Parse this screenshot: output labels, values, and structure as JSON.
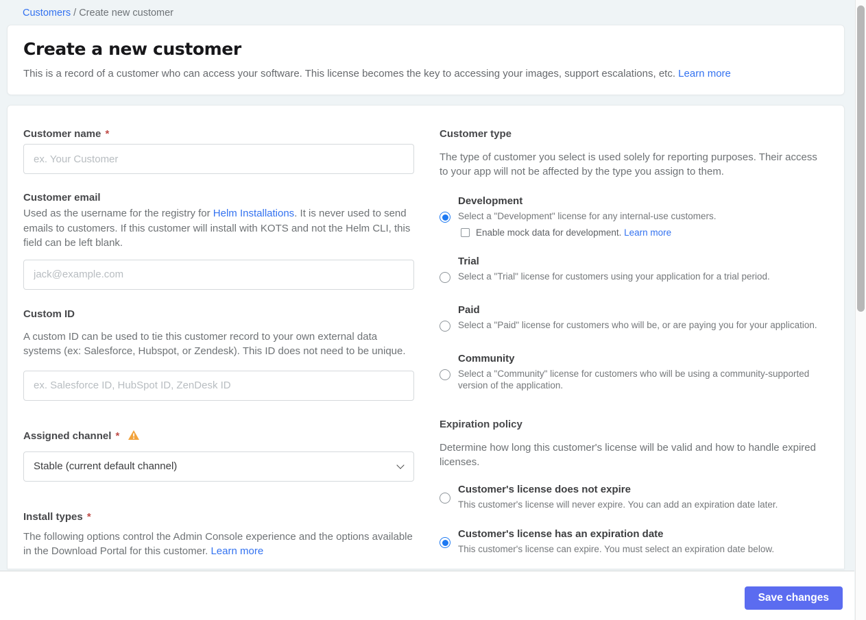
{
  "breadcrumb": {
    "link": "Customers",
    "separator": " / ",
    "current": "Create new customer"
  },
  "header": {
    "title": "Create a new customer",
    "description": "This is a record of a customer who can access your software. This license becomes the key to accessing your images, support escalations, etc. ",
    "learn_more": "Learn more"
  },
  "form": {
    "customer_name": {
      "label": "Customer name",
      "required": "*",
      "placeholder": "ex. Your Customer"
    },
    "customer_email": {
      "label": "Customer email",
      "description_before_link": "Used as the username for the registry for ",
      "link": "Helm Installations",
      "description_after_link": ". It is never used to send emails to customers. If this customer will install with KOTS and not the Helm CLI, this field can be left blank.",
      "placeholder": "jack@example.com"
    },
    "custom_id": {
      "label": "Custom ID",
      "description": "A custom ID can be used to tie this customer record to your own external data systems (ex: Salesforce, Hubspot, or Zendesk). This ID does not need to be unique.",
      "placeholder": "ex. Salesforce ID, HubSpot ID, ZenDesk ID"
    },
    "assigned_channel": {
      "label": "Assigned channel",
      "required": "*",
      "warning_icon": "warning-triangle-icon",
      "selected_option": "Stable (current default channel)"
    },
    "install_types": {
      "label": "Install types",
      "required": "*",
      "description": "The following options control the Admin Console experience and the options available in the Download Portal for this customer. ",
      "learn_more": "Learn more"
    }
  },
  "customer_type": {
    "label": "Customer type",
    "description": "The type of customer you select is used solely for reporting purposes. Their access to your app will not be affected by the type you assign to them.",
    "options": [
      {
        "name": "Development",
        "description": "Select a \"Development\" license for any internal-use customers.",
        "selected": true,
        "checkbox": {
          "label": "Enable mock data for development. ",
          "link": "Learn more",
          "checked": false
        }
      },
      {
        "name": "Trial",
        "description": "Select a \"Trial\" license for customers using your application for a trial period.",
        "selected": false
      },
      {
        "name": "Paid",
        "description": "Select a \"Paid\" license for customers who will be, or are paying you for your application.",
        "selected": false
      },
      {
        "name": "Community",
        "description": "Select a \"Community\" license for customers who will be using a community-supported version of the application.",
        "selected": false
      }
    ]
  },
  "expiration_policy": {
    "label": "Expiration policy",
    "description": "Determine how long this customer's license will be valid and how to handle expired licenses.",
    "options": [
      {
        "name": "Customer's license does not expire",
        "description": "This customer's license will never expire. You can add an expiration date later.",
        "selected": false
      },
      {
        "name": "Customer's license has an expiration date",
        "description": "This customer's license can expire. You must select an expiration date below.",
        "selected": true
      }
    ]
  },
  "footer": {
    "save_label": "Save changes"
  },
  "colors": {
    "page_background": "#eff4f6",
    "link_blue": "#3372f0",
    "radio_accent_blue": "#1d79f2",
    "save_button_indigo": "#5b6cf0",
    "warning_amber": "#f2a33c",
    "required_red": "#bf4b47"
  }
}
